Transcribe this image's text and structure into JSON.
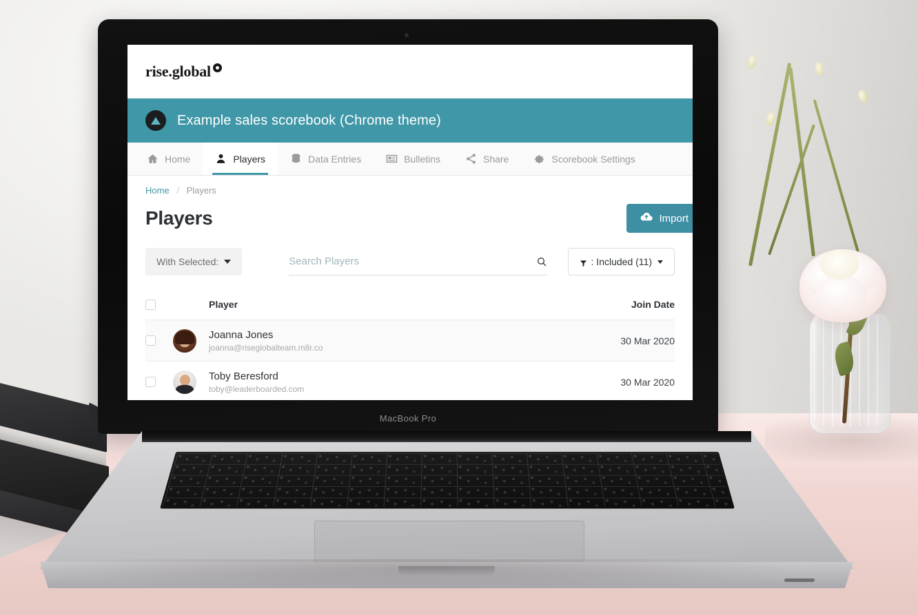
{
  "scene": {
    "device_label": "MacBook Pro"
  },
  "app": {
    "brand": {
      "name": "rise.global",
      "mark_icon": "rise-logo-mark-icon"
    },
    "scorebook": {
      "icon": "scorebook-triangle-icon",
      "title": "Example sales scorebook (Chrome theme)",
      "bar_color": "#3f97a7"
    },
    "tabs": [
      {
        "label": "Home",
        "icon": "home-icon",
        "active": false
      },
      {
        "label": "Players",
        "icon": "user-icon",
        "active": true
      },
      {
        "label": "Data Entries",
        "icon": "database-icon",
        "active": false
      },
      {
        "label": "Bulletins",
        "icon": "newspaper-icon",
        "active": false
      },
      {
        "label": "Share",
        "icon": "share-icon",
        "active": false
      },
      {
        "label": "Scorebook Settings",
        "icon": "gear-icon",
        "active": false
      }
    ],
    "breadcrumb": {
      "home": "Home",
      "separator": "/",
      "current": "Players"
    },
    "page_title": "Players",
    "import_button": {
      "label": "Import",
      "icon": "cloud-upload-icon",
      "color": "#3f8fa3"
    },
    "toolbar": {
      "with_selected_label": "With Selected:",
      "search_placeholder": "Search Players",
      "search_value": "",
      "search_icon": "search-icon",
      "filter_label": ": Included (11)",
      "filter_icon": "funnel-icon"
    },
    "table": {
      "columns": {
        "player": "Player",
        "join_date": "Join Date"
      },
      "rows": [
        {
          "name": "Joanna Jones",
          "email": "joanna@riseglobalteam.m8r.co",
          "join_date": "30 Mar 2020",
          "avatar": "avatar-joanna-jones"
        },
        {
          "name": "Toby Beresford",
          "email": "toby@leaderboarded.com",
          "join_date": "30 Mar 2020",
          "avatar": "avatar-toby-beresford"
        }
      ]
    },
    "colors": {
      "accent_teal": "#3f97a7",
      "link_teal": "#3f97a7",
      "title_dark": "#2c3136"
    }
  }
}
